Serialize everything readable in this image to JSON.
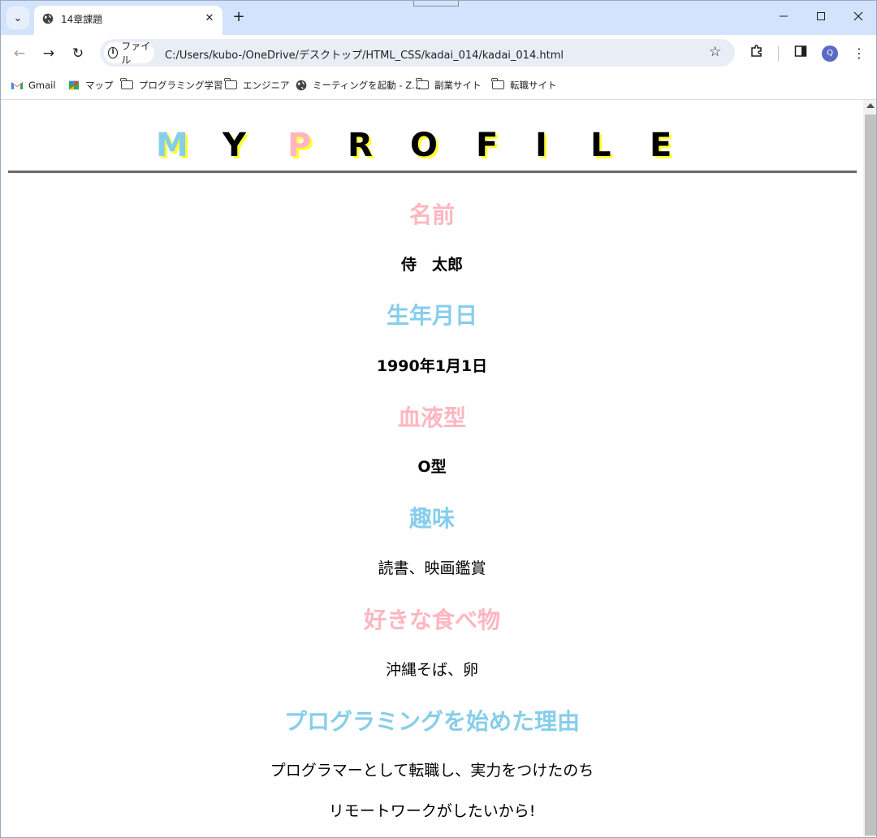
{
  "browser": {
    "tab_title": "14章課題",
    "new_tab_symbol": "+",
    "close_symbol": "✕",
    "window_controls": {
      "minimize": "—",
      "maximize": "☐",
      "close": "✕"
    },
    "nav": {
      "back": "←",
      "forward": "→",
      "reload": "↻"
    },
    "omnibox": {
      "chip_label": "ファイル",
      "url": "C:/Users/kubo-/OneDrive/デスクトップ/HTML_CSS/kadai_014/kadai_014.html"
    },
    "profile_initial": "Q",
    "bookmarks": [
      {
        "label": "Gmail",
        "icon": "gmail-icon"
      },
      {
        "label": "マップ",
        "icon": "maps-icon"
      },
      {
        "label": "プログラミング学習",
        "icon": "folder-icon"
      },
      {
        "label": "エンジニア",
        "icon": "folder-icon"
      },
      {
        "label": "ミーティングを起動 - Z...",
        "icon": "globe-icon"
      },
      {
        "label": "副業サイト",
        "icon": "folder-icon"
      },
      {
        "label": "転職サイト",
        "icon": "folder-icon"
      }
    ]
  },
  "page": {
    "title_letters": [
      "M",
      "Y",
      "P",
      "R",
      "O",
      "F",
      "I",
      "L",
      "E"
    ],
    "colors": {
      "pink": "#ffb6c1",
      "blue": "#87ceeb",
      "shadow": "#ffff33",
      "rule": "#6b6b6b"
    },
    "sections": [
      {
        "heading": "名前",
        "value": "侍　太郎"
      },
      {
        "heading": "生年月日",
        "value": "1990年1月1日"
      },
      {
        "heading": "血液型",
        "value": "O型"
      },
      {
        "heading": "趣味",
        "value": "読書、映画鑑賞"
      },
      {
        "heading": "好きな食べ物",
        "value": "沖縄そば、卵"
      },
      {
        "heading": "プログラミングを始めた理由",
        "value": "プログラマーとして転職し、実力をつけたのち",
        "value2": "リモートワークがしたいから!"
      }
    ]
  }
}
